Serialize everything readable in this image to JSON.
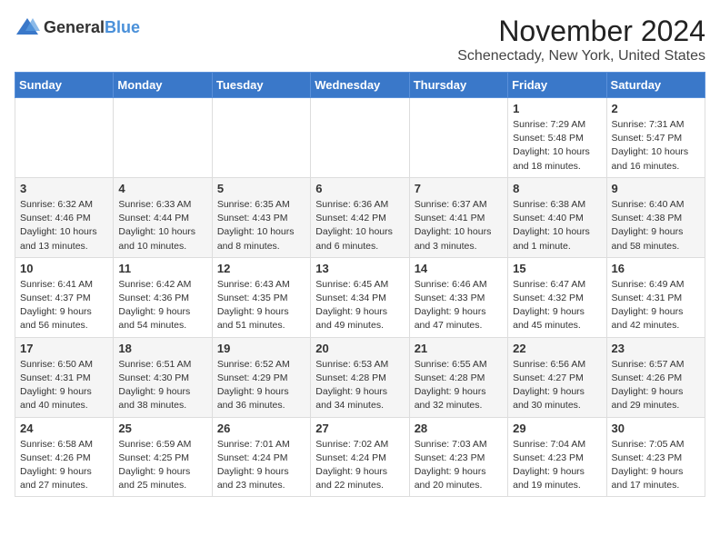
{
  "header": {
    "logo_general": "General",
    "logo_blue": "Blue",
    "month": "November 2024",
    "location": "Schenectady, New York, United States"
  },
  "days_of_week": [
    "Sunday",
    "Monday",
    "Tuesday",
    "Wednesday",
    "Thursday",
    "Friday",
    "Saturday"
  ],
  "weeks": [
    [
      {
        "day": "",
        "info": ""
      },
      {
        "day": "",
        "info": ""
      },
      {
        "day": "",
        "info": ""
      },
      {
        "day": "",
        "info": ""
      },
      {
        "day": "",
        "info": ""
      },
      {
        "day": "1",
        "info": "Sunrise: 7:29 AM\nSunset: 5:48 PM\nDaylight: 10 hours and 18 minutes."
      },
      {
        "day": "2",
        "info": "Sunrise: 7:31 AM\nSunset: 5:47 PM\nDaylight: 10 hours and 16 minutes."
      }
    ],
    [
      {
        "day": "3",
        "info": "Sunrise: 6:32 AM\nSunset: 4:46 PM\nDaylight: 10 hours and 13 minutes."
      },
      {
        "day": "4",
        "info": "Sunrise: 6:33 AM\nSunset: 4:44 PM\nDaylight: 10 hours and 10 minutes."
      },
      {
        "day": "5",
        "info": "Sunrise: 6:35 AM\nSunset: 4:43 PM\nDaylight: 10 hours and 8 minutes."
      },
      {
        "day": "6",
        "info": "Sunrise: 6:36 AM\nSunset: 4:42 PM\nDaylight: 10 hours and 6 minutes."
      },
      {
        "day": "7",
        "info": "Sunrise: 6:37 AM\nSunset: 4:41 PM\nDaylight: 10 hours and 3 minutes."
      },
      {
        "day": "8",
        "info": "Sunrise: 6:38 AM\nSunset: 4:40 PM\nDaylight: 10 hours and 1 minute."
      },
      {
        "day": "9",
        "info": "Sunrise: 6:40 AM\nSunset: 4:38 PM\nDaylight: 9 hours and 58 minutes."
      }
    ],
    [
      {
        "day": "10",
        "info": "Sunrise: 6:41 AM\nSunset: 4:37 PM\nDaylight: 9 hours and 56 minutes."
      },
      {
        "day": "11",
        "info": "Sunrise: 6:42 AM\nSunset: 4:36 PM\nDaylight: 9 hours and 54 minutes."
      },
      {
        "day": "12",
        "info": "Sunrise: 6:43 AM\nSunset: 4:35 PM\nDaylight: 9 hours and 51 minutes."
      },
      {
        "day": "13",
        "info": "Sunrise: 6:45 AM\nSunset: 4:34 PM\nDaylight: 9 hours and 49 minutes."
      },
      {
        "day": "14",
        "info": "Sunrise: 6:46 AM\nSunset: 4:33 PM\nDaylight: 9 hours and 47 minutes."
      },
      {
        "day": "15",
        "info": "Sunrise: 6:47 AM\nSunset: 4:32 PM\nDaylight: 9 hours and 45 minutes."
      },
      {
        "day": "16",
        "info": "Sunrise: 6:49 AM\nSunset: 4:31 PM\nDaylight: 9 hours and 42 minutes."
      }
    ],
    [
      {
        "day": "17",
        "info": "Sunrise: 6:50 AM\nSunset: 4:31 PM\nDaylight: 9 hours and 40 minutes."
      },
      {
        "day": "18",
        "info": "Sunrise: 6:51 AM\nSunset: 4:30 PM\nDaylight: 9 hours and 38 minutes."
      },
      {
        "day": "19",
        "info": "Sunrise: 6:52 AM\nSunset: 4:29 PM\nDaylight: 9 hours and 36 minutes."
      },
      {
        "day": "20",
        "info": "Sunrise: 6:53 AM\nSunset: 4:28 PM\nDaylight: 9 hours and 34 minutes."
      },
      {
        "day": "21",
        "info": "Sunrise: 6:55 AM\nSunset: 4:28 PM\nDaylight: 9 hours and 32 minutes."
      },
      {
        "day": "22",
        "info": "Sunrise: 6:56 AM\nSunset: 4:27 PM\nDaylight: 9 hours and 30 minutes."
      },
      {
        "day": "23",
        "info": "Sunrise: 6:57 AM\nSunset: 4:26 PM\nDaylight: 9 hours and 29 minutes."
      }
    ],
    [
      {
        "day": "24",
        "info": "Sunrise: 6:58 AM\nSunset: 4:26 PM\nDaylight: 9 hours and 27 minutes."
      },
      {
        "day": "25",
        "info": "Sunrise: 6:59 AM\nSunset: 4:25 PM\nDaylight: 9 hours and 25 minutes."
      },
      {
        "day": "26",
        "info": "Sunrise: 7:01 AM\nSunset: 4:24 PM\nDaylight: 9 hours and 23 minutes."
      },
      {
        "day": "27",
        "info": "Sunrise: 7:02 AM\nSunset: 4:24 PM\nDaylight: 9 hours and 22 minutes."
      },
      {
        "day": "28",
        "info": "Sunrise: 7:03 AM\nSunset: 4:23 PM\nDaylight: 9 hours and 20 minutes."
      },
      {
        "day": "29",
        "info": "Sunrise: 7:04 AM\nSunset: 4:23 PM\nDaylight: 9 hours and 19 minutes."
      },
      {
        "day": "30",
        "info": "Sunrise: 7:05 AM\nSunset: 4:23 PM\nDaylight: 9 hours and 17 minutes."
      }
    ]
  ]
}
